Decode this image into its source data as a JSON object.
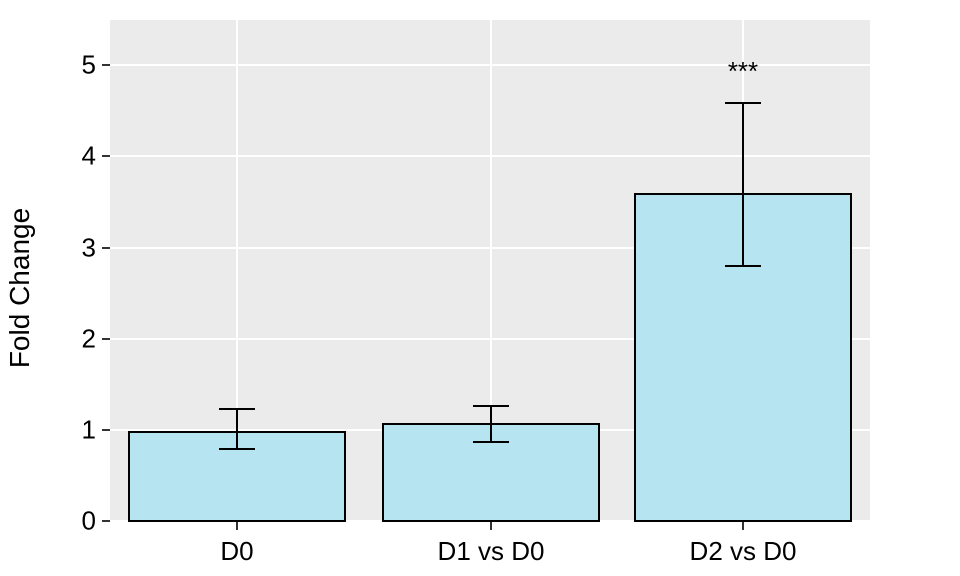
{
  "chart_data": {
    "type": "bar",
    "categories": [
      "D0",
      "D1 vs D0",
      "D2 vs D0"
    ],
    "values": [
      1.0,
      1.08,
      3.6
    ],
    "error_lower": [
      0.2,
      0.2,
      0.8
    ],
    "error_upper": [
      0.25,
      0.2,
      1.0
    ],
    "annotations": [
      {
        "category": "D2 vs D0",
        "label": "***",
        "y": 5.0
      }
    ],
    "title": "",
    "xlabel": "",
    "ylabel": "Fold Change",
    "ylim": [
      0,
      5.5
    ],
    "y_ticks": [
      0,
      1,
      2,
      3,
      4,
      5
    ],
    "grid": true,
    "bar_fill": "#b6e4f1",
    "bar_stroke": "#000000"
  }
}
